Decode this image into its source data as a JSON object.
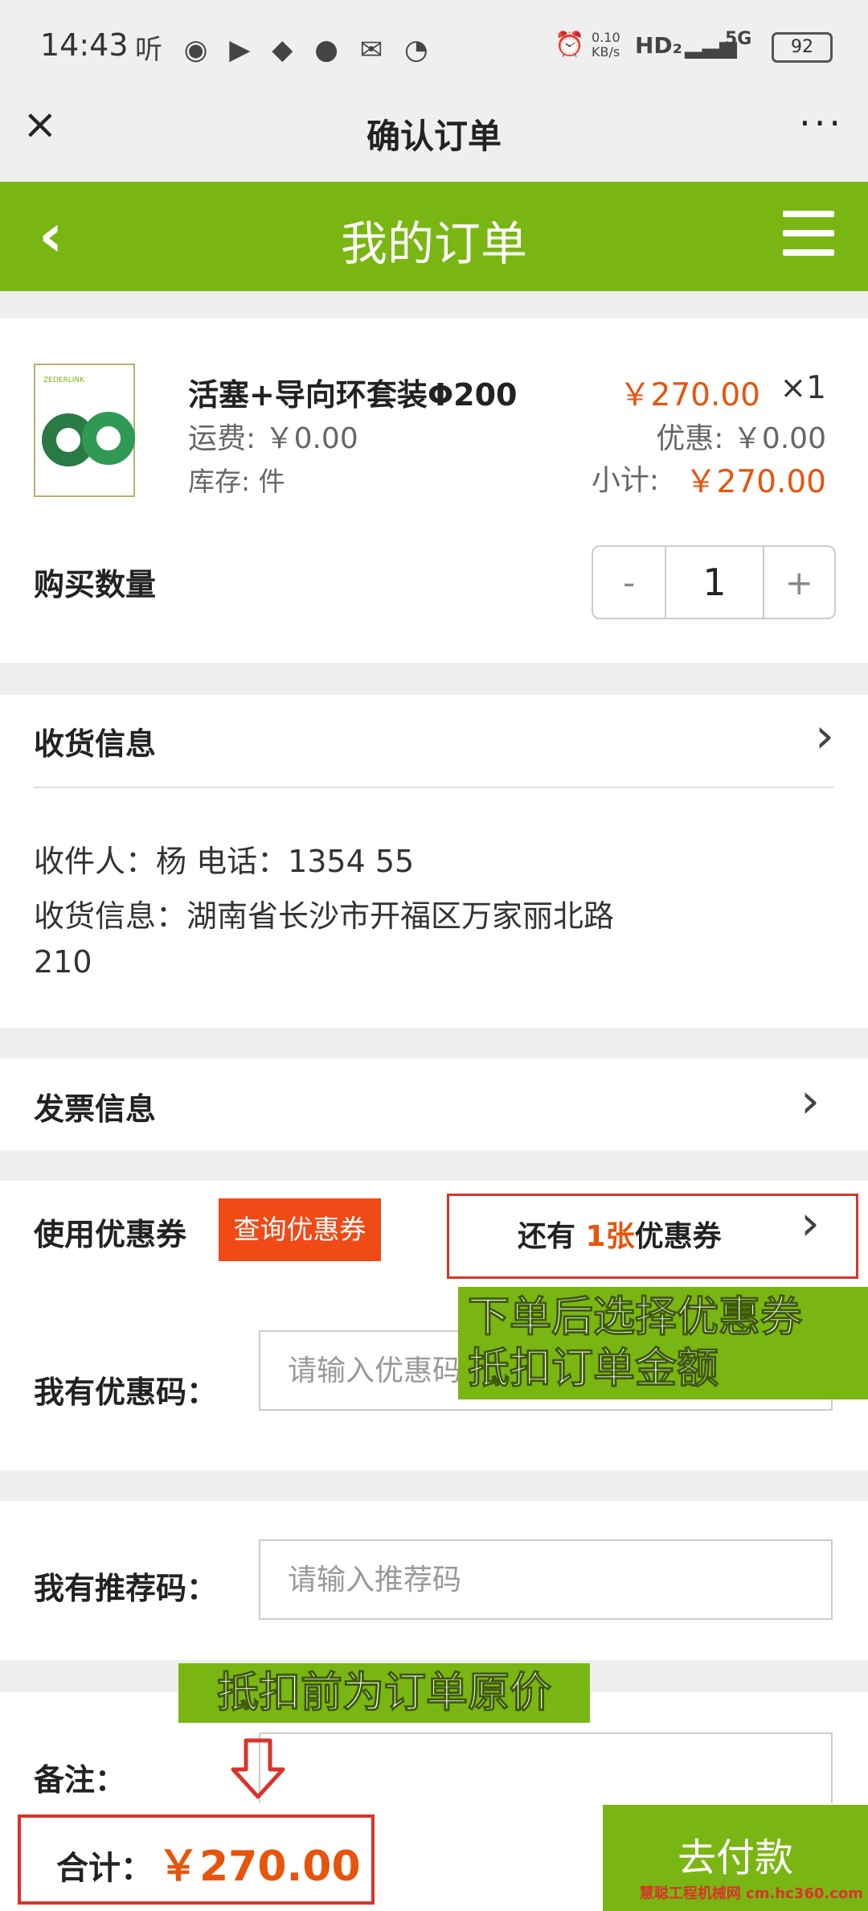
{
  "status_bar": {
    "time": "14:43",
    "left_icons": "听 ◉ ▶ ◆ ● ✉ ◔",
    "net_speed": "0.10 KB/s",
    "hd": "HD₂",
    "signal": "5G",
    "battery": "92"
  },
  "wechat_bar": {
    "close_icon": "×",
    "title": "确认订单",
    "more_icon": "···"
  },
  "header": {
    "back_icon": "‹",
    "title": "我的订单"
  },
  "product": {
    "thumb_brand": "ZEDERLINK",
    "name": "活塞+导向环套装Φ200",
    "shipping": "运费: ￥0.00",
    "stock": "库存:  件",
    "price": "￥270.00",
    "qty_display": "×1",
    "discount": "优惠: ￥0.00",
    "subtotal_label": "小计:",
    "subtotal": "￥270.00"
  },
  "quantity": {
    "label": "购买数量",
    "minus": "-",
    "value": "1",
    "plus": "+"
  },
  "shipping_info": {
    "title": "收货信息",
    "recipient_line": "收件人：杨     电话：1354          55",
    "address_line": "收货信息：湖南省长沙市开福区万家丽北路",
    "address_line2": "210"
  },
  "invoice": {
    "title": "发票信息"
  },
  "coupon": {
    "label": "使用优惠券",
    "query_button": "查询优惠券",
    "prefix": "还有 ",
    "count": "1张",
    "suffix": "优惠券"
  },
  "promo_code": {
    "label": "我有优惠码：",
    "placeholder": "请输入优惠码"
  },
  "referral_code": {
    "label": "我有推荐码：",
    "placeholder": "请输入推荐码"
  },
  "remark": {
    "label": "备注："
  },
  "annotations": {
    "coupon_tip_line1": "下单后选择优惠券",
    "coupon_tip_line2": "抵扣订单金额",
    "price_tip": "抵扣前为订单原价"
  },
  "footer": {
    "total_label": "合计：",
    "total_value": "￥270.00",
    "pay_button": "去付款",
    "watermark": "慧聪工程机械网 cm.hc360.com"
  },
  "colors": {
    "brand_green": "#7ab613",
    "price_orange": "#e8540b",
    "highlight_red": "#d9342b"
  }
}
